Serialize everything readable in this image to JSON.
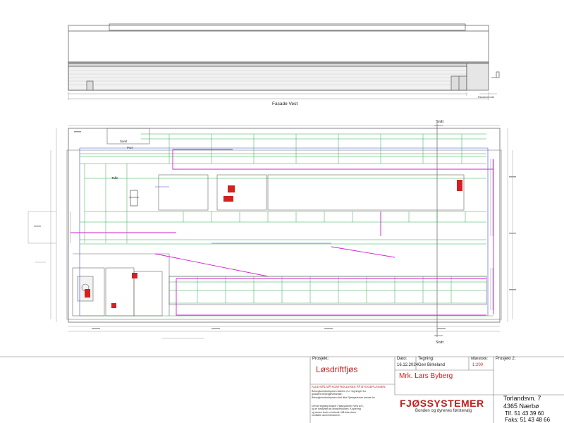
{
  "elevation": {
    "caption": "Fasade Vest",
    "side_label": "Eksisterende"
  },
  "plan": {
    "section_label_top": "Snitt",
    "section_label_bottom": "Snitt",
    "room_labels": [
      "Sanit",
      "Port",
      "Tafle"
    ]
  },
  "title_block": {
    "project_label": "Prosjekt:",
    "project_name": "Løsdriftfjøs",
    "date_label": "Dato:",
    "date_value": "16.12.2024",
    "drawing_label": "Tegning:",
    "drawing_value": "Geir Birkeland",
    "scale_label": "Målestokk:",
    "scale_value": "1:200",
    "project2_label": "Prosjekt 2:",
    "client": "Mrk. Lars Byberg",
    "warning": "ALLE MÅL MÅ KONTROLLERES PÅ BYGGEPLASSEN",
    "notes_upper": "Betongkonstruksjonen utføres i h.t. tegninger fra\ngodkjent betongleverandør.\nBetongkonstruksjonen skal ikke Fjøssystemer ansvar for.",
    "notes_lower": "Denne tegning tilhører Fjøssystemer Vest A/S,\nog er beskyttet av åndsverkloven. Kopiering\nog annen bruk er forbudt. Må ikke vises\nmedfølre annen/brukeren.",
    "logo_text": "FJØSSYSTEMER",
    "logo_tagline": "Bonden og dyrenes førstevalg",
    "address_street": "Torlandsvn. 7",
    "address_city": "4365 Nærbø",
    "phone": "Tlf. 51 43 39 60",
    "fax": "Faks: 51 43 48 66"
  },
  "colors": {
    "line": "#555555",
    "green": "#2eaa4a",
    "magenta": "#d21fd2",
    "red": "#d32020",
    "blue": "#3a4fd8"
  }
}
